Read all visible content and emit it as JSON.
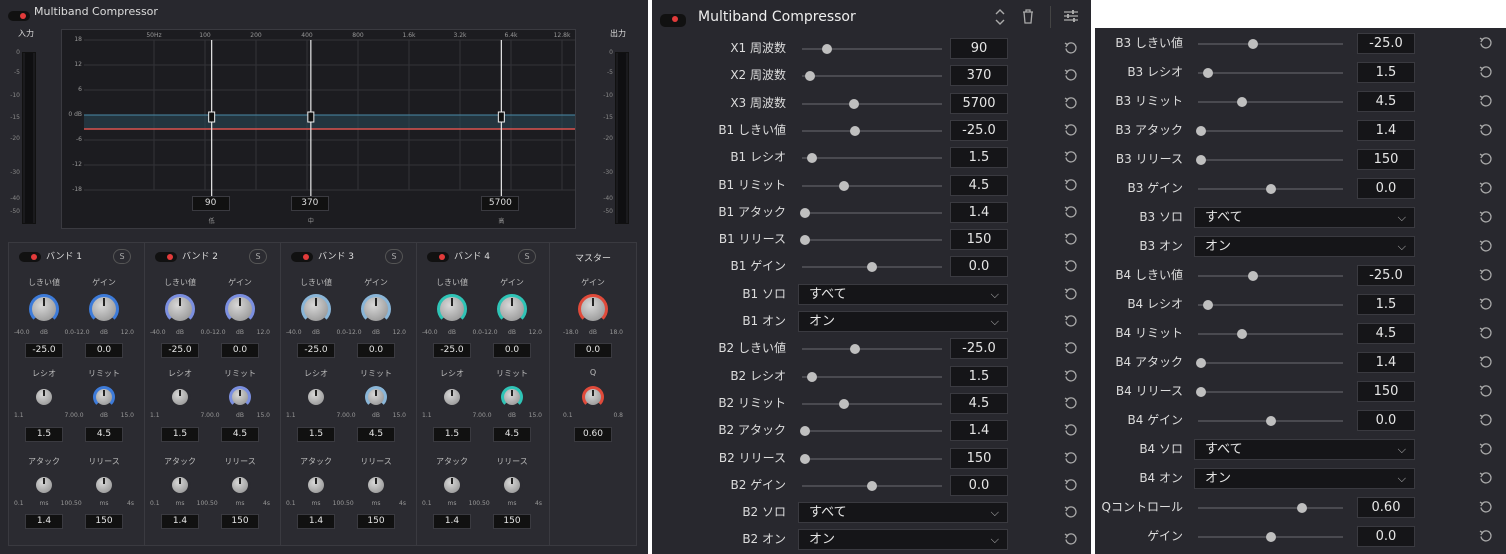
{
  "title": "Multiband Compressor",
  "panel1": {
    "input_label": "入力",
    "output_label": "出力",
    "meter_scale": [
      "0",
      "-5",
      "-10",
      "-15",
      "-20",
      "-30",
      "-40",
      "-50"
    ],
    "eq": {
      "freq_labels": [
        "50Hz",
        "100",
        "200",
        "400",
        "800",
        "1.6k",
        "3.2k",
        "6.4k",
        "12.8k"
      ],
      "db_labels": [
        "18",
        "12",
        "6",
        "0 dB",
        "-6",
        "-12",
        "-18"
      ],
      "crossovers": [
        {
          "value": "90",
          "label": "低",
          "fraction": 0.26
        },
        {
          "value": "370",
          "label": "中",
          "fraction": 0.462
        },
        {
          "value": "5700",
          "label": "高",
          "fraction": 0.85
        }
      ]
    },
    "bands": [
      {
        "name": "バンド 1",
        "color": "#3d7bd9",
        "threshold": "-25.0",
        "gain": "0.0",
        "ratio": "1.5",
        "limit": "4.5",
        "attack": "1.4",
        "release": "150"
      },
      {
        "name": "バンド 2",
        "color": "#7b8fe0",
        "threshold": "-25.0",
        "gain": "0.0",
        "ratio": "1.5",
        "limit": "4.5",
        "attack": "1.4",
        "release": "150"
      },
      {
        "name": "バンド 3",
        "color": "#8ab6d8",
        "threshold": "-25.0",
        "gain": "0.0",
        "ratio": "1.5",
        "limit": "4.5",
        "attack": "1.4",
        "release": "150"
      },
      {
        "name": "バンド 4",
        "color": "#2fc4b6",
        "threshold": "-25.0",
        "gain": "0.0",
        "ratio": "1.5",
        "limit": "4.5",
        "attack": "1.4",
        "release": "150"
      }
    ],
    "band_labels": {
      "solo": "S",
      "threshold": "しきい値",
      "gain": "ゲイン",
      "ratio": "レシオ",
      "limit": "リミット",
      "attack": "アタック",
      "release": "リリース",
      "threshold_min": "-40.0",
      "threshold_unit": "dB",
      "threshold_max": "0.0",
      "gain_min": "-12.0",
      "gain_unit": "dB",
      "gain_max": "12.0",
      "ratio_min": "1.1",
      "ratio_max": "7.0",
      "limit_min": "0.0",
      "limit_unit": "dB",
      "limit_max": "15.0",
      "attack_min": "0.1",
      "attack_unit": "ms",
      "attack_max": "100.",
      "release_min": "50",
      "release_unit": "ms",
      "release_max": "4s"
    },
    "master": {
      "title": "マスター",
      "gain_label": "ゲイン",
      "gain_min": "-18.0",
      "gain_unit": "dB",
      "gain_max": "18.0",
      "gain": "0.0",
      "q_label": "Q",
      "q_min": "0.1",
      "q_max": "0.8",
      "q": "0.60",
      "color": "#e04a3a"
    }
  },
  "panel2": {
    "rows": [
      {
        "label": "X1 周波数",
        "type": "slider",
        "value": "90",
        "pos": 0.18
      },
      {
        "label": "X2 周波数",
        "type": "slider",
        "value": "370",
        "pos": 0.06
      },
      {
        "label": "X3 周波数",
        "type": "slider",
        "value": "5700",
        "pos": 0.37
      },
      {
        "label": "B1 しきい値",
        "type": "slider",
        "value": "-25.0",
        "pos": 0.38
      },
      {
        "label": "B1 レシオ",
        "type": "slider",
        "value": "1.5",
        "pos": 0.07
      },
      {
        "label": "B1 リミット",
        "type": "slider",
        "value": "4.5",
        "pos": 0.3
      },
      {
        "label": "B1 アタック",
        "type": "slider",
        "value": "1.4",
        "pos": 0.02
      },
      {
        "label": "B1 リリース",
        "type": "slider",
        "value": "150",
        "pos": 0.02
      },
      {
        "label": "B1 ゲイン",
        "type": "slider",
        "value": "0.0",
        "pos": 0.5
      },
      {
        "label": "B1 ソロ",
        "type": "dropdown",
        "value": "すべて"
      },
      {
        "label": "B1 オン",
        "type": "dropdown",
        "value": "オン"
      },
      {
        "label": "B2 しきい値",
        "type": "slider",
        "value": "-25.0",
        "pos": 0.38
      },
      {
        "label": "B2 レシオ",
        "type": "slider",
        "value": "1.5",
        "pos": 0.07
      },
      {
        "label": "B2 リミット",
        "type": "slider",
        "value": "4.5",
        "pos": 0.3
      },
      {
        "label": "B2 アタック",
        "type": "slider",
        "value": "1.4",
        "pos": 0.02
      },
      {
        "label": "B2 リリース",
        "type": "slider",
        "value": "150",
        "pos": 0.02
      },
      {
        "label": "B2 ゲイン",
        "type": "slider",
        "value": "0.0",
        "pos": 0.5
      },
      {
        "label": "B2 ソロ",
        "type": "dropdown",
        "value": "すべて"
      },
      {
        "label": "B2 オン",
        "type": "dropdown",
        "value": "オン"
      }
    ]
  },
  "panel3": {
    "rows": [
      {
        "label": "B3 しきい値",
        "type": "slider",
        "value": "-25.0",
        "pos": 0.38
      },
      {
        "label": "B3 レシオ",
        "type": "slider",
        "value": "1.5",
        "pos": 0.07
      },
      {
        "label": "B3 リミット",
        "type": "slider",
        "value": "4.5",
        "pos": 0.3
      },
      {
        "label": "B3 アタック",
        "type": "slider",
        "value": "1.4",
        "pos": 0.02
      },
      {
        "label": "B3 リリース",
        "type": "slider",
        "value": "150",
        "pos": 0.02
      },
      {
        "label": "B3 ゲイン",
        "type": "slider",
        "value": "0.0",
        "pos": 0.5
      },
      {
        "label": "B3 ソロ",
        "type": "dropdown",
        "value": "すべて"
      },
      {
        "label": "B3 オン",
        "type": "dropdown",
        "value": "オン"
      },
      {
        "label": "B4 しきい値",
        "type": "slider",
        "value": "-25.0",
        "pos": 0.38
      },
      {
        "label": "B4 レシオ",
        "type": "slider",
        "value": "1.5",
        "pos": 0.07
      },
      {
        "label": "B4 リミット",
        "type": "slider",
        "value": "4.5",
        "pos": 0.3
      },
      {
        "label": "B4 アタック",
        "type": "slider",
        "value": "1.4",
        "pos": 0.02
      },
      {
        "label": "B4 リリース",
        "type": "slider",
        "value": "150",
        "pos": 0.02
      },
      {
        "label": "B4 ゲイン",
        "type": "slider",
        "value": "0.0",
        "pos": 0.5
      },
      {
        "label": "B4 ソロ",
        "type": "dropdown",
        "value": "すべて"
      },
      {
        "label": "B4 オン",
        "type": "dropdown",
        "value": "オン"
      },
      {
        "label": "Qコントロール",
        "type": "slider",
        "value": "0.60",
        "pos": 0.72
      },
      {
        "label": "ゲイン",
        "type": "slider",
        "value": "0.0",
        "pos": 0.5
      }
    ]
  }
}
